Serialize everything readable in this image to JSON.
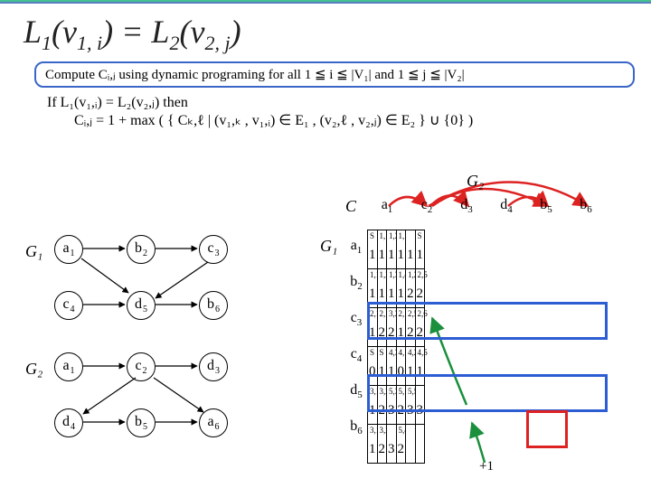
{
  "title": "L₁(v₁,ᵢ) = L₂(v₂,ⱼ)",
  "statement": "Compute Cᵢ,ⱼ using dynamic programing for all 1 ≦ i ≦ |V₁| and 1 ≦ j ≦ |V₂|",
  "iftext": {
    "line1": "If L₁(v₁,ᵢ) = L₂(v₂,ⱼ) then",
    "line2": "Cᵢ,ⱼ = 1 + max ( { Cₖ,ℓ | (v₁,ₖ , v₁,ᵢ) ∈ E₁ , (v₂,ℓ , v₂,ⱼ) ∈ E₂ } ∪ {0} )"
  },
  "graph_labels": {
    "G1": "G₁",
    "G2": "G₂",
    "Gtop": "G₂",
    "Gside": "G₁",
    "C": "C"
  },
  "G1_nodes": [
    {
      "label": "a",
      "sub": "1"
    },
    {
      "label": "b",
      "sub": "2"
    },
    {
      "label": "c",
      "sub": "3"
    },
    {
      "label": "c",
      "sub": "4"
    },
    {
      "label": "d",
      "sub": "5"
    },
    {
      "label": "b",
      "sub": "6"
    }
  ],
  "G2_nodes": [
    {
      "label": "a",
      "sub": "1"
    },
    {
      "label": "c",
      "sub": "2"
    },
    {
      "label": "d",
      "sub": "3"
    },
    {
      "label": "d",
      "sub": "4"
    },
    {
      "label": "b",
      "sub": "5"
    },
    {
      "label": "a",
      "sub": "6"
    }
  ],
  "cols": [
    {
      "label": "a",
      "sub": "1"
    },
    {
      "label": "c",
      "sub": "2"
    },
    {
      "label": "d",
      "sub": "3"
    },
    {
      "label": "d",
      "sub": "4"
    },
    {
      "label": "b",
      "sub": "5"
    },
    {
      "label": "b",
      "sub": "6"
    }
  ],
  "rows": [
    {
      "label": "a",
      "sub": "1"
    },
    {
      "label": "b",
      "sub": "2"
    },
    {
      "label": "c",
      "sub": "3"
    },
    {
      "label": "c",
      "sub": "4"
    },
    {
      "label": "d",
      "sub": "5"
    },
    {
      "label": "b",
      "sub": "6"
    }
  ],
  "matrix": [
    [
      {
        "v": "1",
        "s": "S"
      },
      {
        "v": "1",
        "s": "1,1"
      },
      {
        "v": "1",
        "s": "1,2"
      },
      {
        "v": "1",
        "s": "1,1"
      },
      {
        "v": "1",
        "s": ""
      },
      {
        "v": "1",
        "s": "S"
      }
    ],
    [
      {
        "v": "1",
        "s": "1,1"
      },
      {
        "v": "1",
        "s": "1,2"
      },
      {
        "v": "1",
        "s": "1,3"
      },
      {
        "v": "1",
        "s": "1,4"
      },
      {
        "v": "2",
        "s": "1,2"
      },
      {
        "v": "2",
        "s": "2,5"
      }
    ],
    [
      {
        "v": "1",
        "s": "2,1"
      },
      {
        "v": "2",
        "s": "2,1"
      },
      {
        "v": "2",
        "s": "3,2"
      },
      {
        "v": "1",
        "s": "2,1"
      },
      {
        "v": "2",
        "s": "2,5"
      },
      {
        "v": "2",
        "s": "2,6"
      }
    ],
    [
      {
        "v": "0",
        "s": "S"
      },
      {
        "v": "1",
        "s": "S"
      },
      {
        "v": "1",
        "s": "4,3"
      },
      {
        "v": "0",
        "s": "4,1"
      },
      {
        "v": "1",
        "s": "4,2"
      },
      {
        "v": "1",
        "s": "4,5"
      }
    ],
    [
      {
        "v": "1",
        "s": "3,1"
      },
      {
        "v": "2",
        "s": "3,2"
      },
      {
        "v": "3",
        "s": "5,3"
      },
      {
        "v": "2",
        "s": "5,1"
      },
      {
        "v": "3",
        "s": "5,5"
      },
      {
        "v": "3",
        "s": ""
      }
    ],
    [
      {
        "v": "1",
        "s": "3,1"
      },
      {
        "v": "2",
        "s": "3,2"
      },
      {
        "v": "3",
        "s": ""
      },
      {
        "v": "2",
        "s": "5,4"
      },
      {
        "v": "",
        "s": ""
      },
      {
        "v": "",
        "s": ""
      }
    ]
  ],
  "plus1": "+1"
}
